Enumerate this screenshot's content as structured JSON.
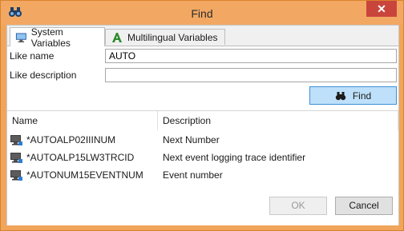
{
  "window": {
    "title": "Find",
    "close_glyph": "✕"
  },
  "tabs": [
    {
      "label": "System Variables",
      "icon": "monitor-icon",
      "active": true
    },
    {
      "label": "Multilingual Variables",
      "icon": "font-a-icon",
      "active": false
    }
  ],
  "form": {
    "like_name_label": "Like name",
    "like_name_value": "AUTO",
    "like_description_label": "Like description",
    "like_description_value": ""
  },
  "find_button": {
    "label": "Find",
    "icon": "binoculars-icon"
  },
  "results": {
    "columns": [
      "Name",
      "Description"
    ],
    "rows": [
      {
        "name": "*AUTOALP02IIINUM",
        "description": "Next Number"
      },
      {
        "name": "*AUTOALP15LW3TRCID",
        "description": "Next event logging trace identifier"
      },
      {
        "name": "*AUTONUM15EVENTNUM",
        "description": "Event number"
      }
    ]
  },
  "footer": {
    "ok_label": "OK",
    "cancel_label": "Cancel"
  },
  "colors": {
    "titlebar": "#f2a863",
    "close": "#c9453c",
    "find_button": "#bee0fa",
    "find_border": "#3c8fd6"
  }
}
